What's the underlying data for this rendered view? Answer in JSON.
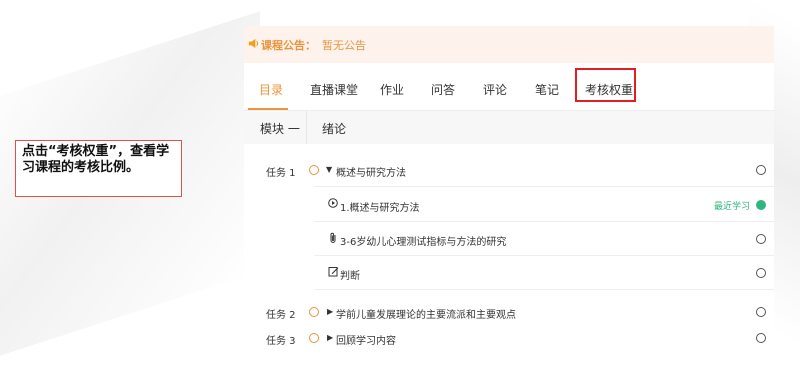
{
  "callout": {
    "text": "点击“考核权重”，查看学习课程的考核比例。"
  },
  "notice": {
    "label": "课程公告：",
    "text": "暂无公告",
    "icon": "speaker-icon"
  },
  "tabs": [
    {
      "label": "目录",
      "active": true
    },
    {
      "label": "直播课堂"
    },
    {
      "label": "作业"
    },
    {
      "label": "问答"
    },
    {
      "label": "评论"
    },
    {
      "label": "笔记"
    },
    {
      "label": "考核权重",
      "highlighted": true
    }
  ],
  "module": {
    "label": "模块 一",
    "title": "绪论"
  },
  "tasks": [
    {
      "label": "任务 1",
      "title": "概述与研究方法",
      "expanded": true,
      "items": [
        {
          "icon": "play-icon",
          "title": "1.概述与研究方法",
          "recent_label": "最近学习"
        },
        {
          "icon": "attachment-icon",
          "title": "3-6岁幼儿心理测试指标与方法的研究"
        },
        {
          "icon": "edit-icon",
          "title": "判断"
        }
      ]
    },
    {
      "label": "任务 2",
      "title": "学前儿童发展理论的主要流派和主要观点",
      "expanded": false
    },
    {
      "label": "任务 3",
      "title": "回顾学习内容",
      "expanded": false
    }
  ],
  "colors": {
    "accent": "#e9953e",
    "highlight_border": "#e02020",
    "recent": "#2fb67c",
    "notice_bg": "#fdf3ec"
  }
}
